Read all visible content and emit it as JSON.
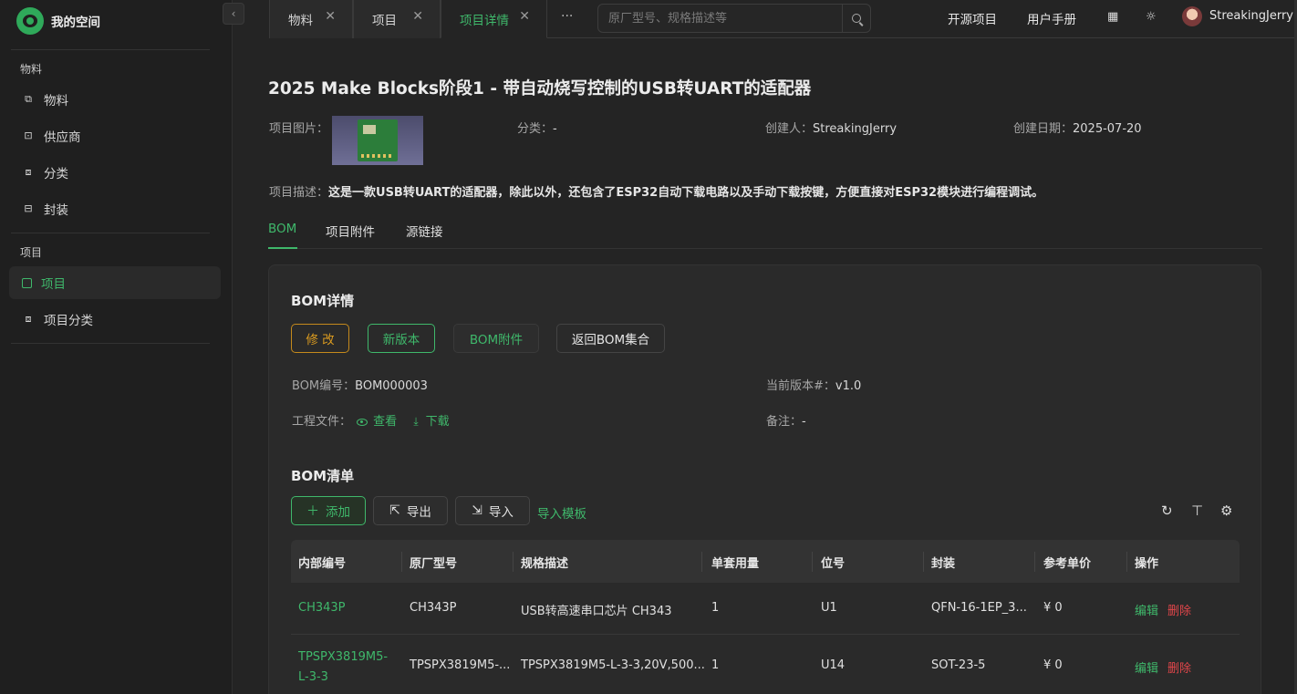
{
  "sidebar": {
    "brand": "我的空间",
    "collapse_icon": "‹",
    "groups": [
      {
        "title": "物料",
        "items": [
          {
            "label": "物料",
            "icon": "materials-icon"
          },
          {
            "label": "供应商",
            "icon": "supplier-icon"
          },
          {
            "label": "分类",
            "icon": "category-icon"
          },
          {
            "label": "封装",
            "icon": "package-icon"
          }
        ]
      },
      {
        "title": "项目",
        "items": [
          {
            "label": "项目",
            "icon": "project-icon",
            "active": true
          },
          {
            "label": "项目分类",
            "icon": "project-category-icon"
          }
        ]
      }
    ]
  },
  "tabs": [
    {
      "label": "物料",
      "close": "✕"
    },
    {
      "label": "项目",
      "close": "✕"
    },
    {
      "label": "项目详情",
      "close": "✕",
      "active": true
    }
  ],
  "tabs_more": "···",
  "search": {
    "placeholder": "原厂型号、规格描述等"
  },
  "header": {
    "open_source": "开源项目",
    "manual": "用户手册",
    "language_icon": "language-icon",
    "theme_icon": "sun-icon",
    "username": "StreakingJerry"
  },
  "project": {
    "title": "2025 Make Blocks阶段1 - 带自动烧写控制的USB转UART的适配器",
    "image_label": "项目图片：",
    "category_label": "分类：",
    "category_value": "-",
    "creator_label": "创建人：",
    "creator_value": "StreakingJerry",
    "created_label": "创建日期：",
    "created_value": "2025-07-20",
    "desc_label": "项目描述：",
    "desc_value": "这是一款USB转UART的适配器，除此以外，还包含了ESP32自动下载电路以及手动下载按键，方便直接对ESP32模块进行编程调试。"
  },
  "subtabs": [
    "BOM",
    "项目附件",
    "源链接"
  ],
  "bom": {
    "title": "BOM详情",
    "btn_edit": "修 改",
    "btn_new_version": "新版本",
    "btn_attachments": "BOM附件",
    "btn_back": "返回BOM集合",
    "number_label": "BOM编号：",
    "number_value": "BOM000003",
    "version_label": "当前版本#：",
    "version_value": "v1.0",
    "files_label": "工程文件：",
    "files_view": "查看",
    "files_download": "下载",
    "notes_label": "备注：",
    "notes_value": "-"
  },
  "bom_list": {
    "title": "BOM清单",
    "add": "添加",
    "export": "导出",
    "import": "导入",
    "template": "导入模板",
    "columns": [
      "内部编号",
      "原厂型号",
      "规格描述",
      "单套用量",
      "位号",
      "封装",
      "参考单价",
      "操作"
    ],
    "rows": [
      {
        "code": "CH343P",
        "model": "CH343P",
        "spec": "USB转高速串口芯片 CH343",
        "qty": "1",
        "ref": "U1",
        "package": "QFN-16-1EP_3...",
        "price": "¥ 0",
        "edit": "编辑",
        "delete": "删除"
      },
      {
        "code": "TPSPX3819M5-L-3-3",
        "model": "TPSPX3819M5-...",
        "spec": "TPSPX3819M5-L-3-3,20V,500...",
        "qty": "1",
        "ref": "U14",
        "package": "SOT-23-5",
        "price": "¥ 0",
        "edit": "编辑",
        "delete": "删除"
      }
    ]
  },
  "colors": {
    "accent": "#3fb86b",
    "warning": "#d99a20",
    "danger": "#e0464a",
    "background": "#242424"
  }
}
